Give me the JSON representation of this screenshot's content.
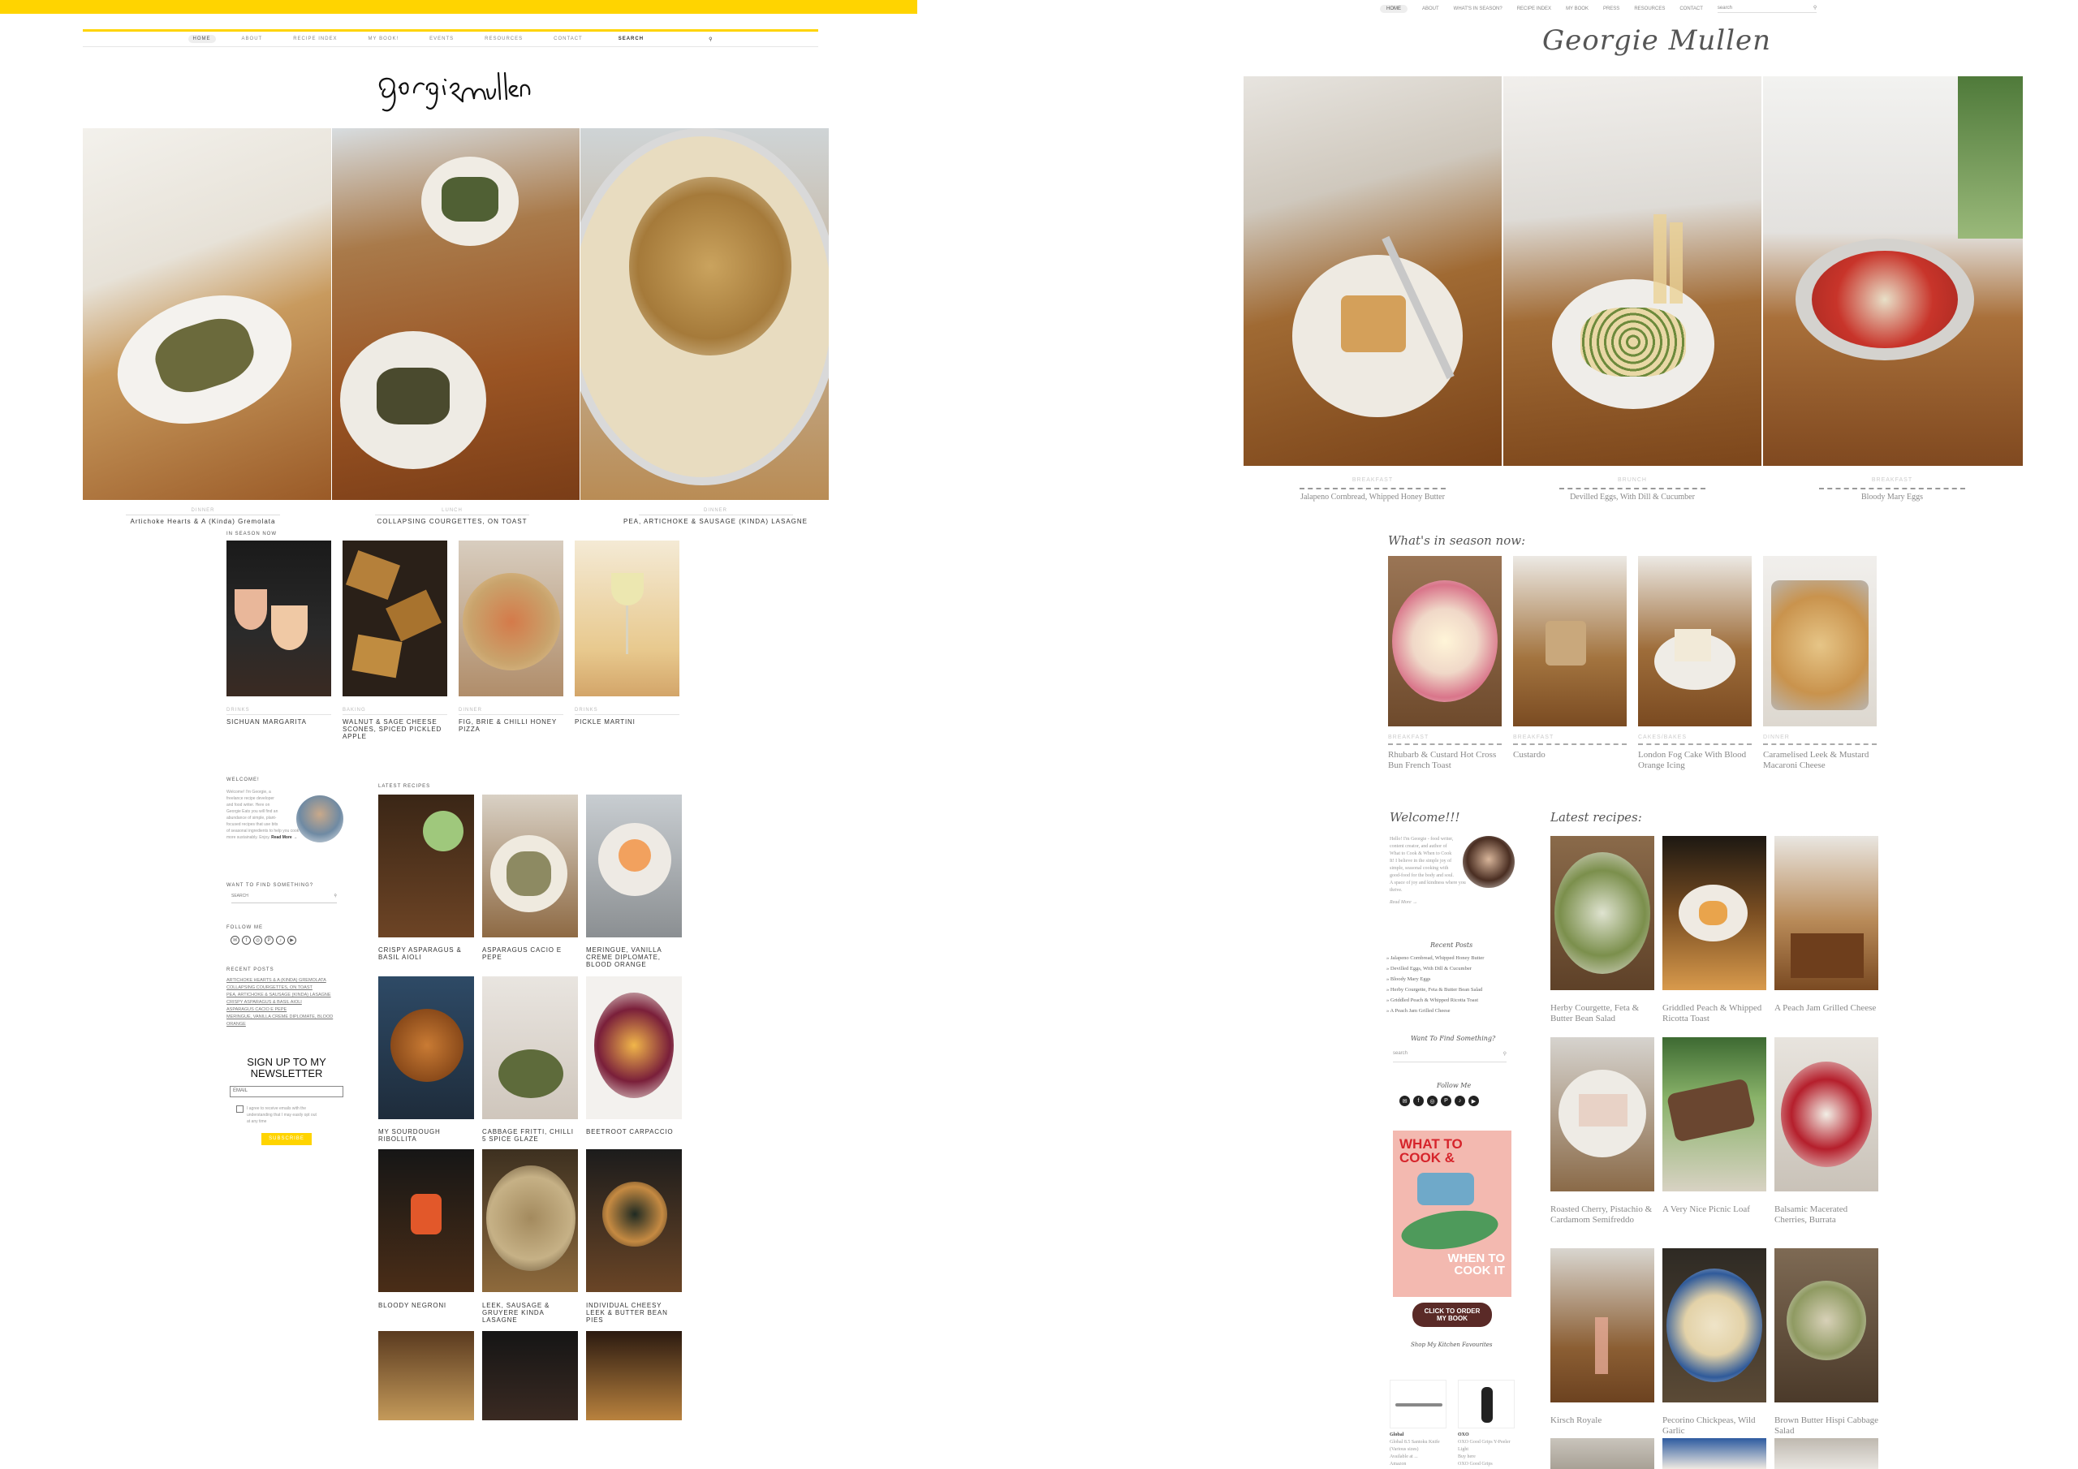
{
  "left": {
    "nav": {
      "items": [
        "HOME",
        "ABOUT",
        "RECIPE INDEX",
        "MY BOOK!",
        "EVENTS",
        "RESOURCES",
        "CONTACT"
      ],
      "search_label": "SEARCH"
    },
    "hero": [
      {
        "category": "DINNER",
        "title": "Artichoke Hearts & A (Kinda) Gremolata"
      },
      {
        "category": "LUNCH",
        "title": "COLLAPSING COURGETTES, ON TOAST"
      },
      {
        "category": "DINNER",
        "title": "PEA, ARTICHOKE & SAUSAGE (KINDA) LASAGNE"
      }
    ],
    "in_season": {
      "heading": "IN SEASON NOW",
      "cards": [
        {
          "category": "DRINKS",
          "title": "SICHUAN MARGARITA"
        },
        {
          "category": "BAKING",
          "title": "WALNUT & SAGE CHEESE SCONES, SPICED PICKLED APPLE"
        },
        {
          "category": "DINNER",
          "title": "FIG, BRIE & CHILLI HONEY PIZZA"
        },
        {
          "category": "DRINKS",
          "title": "PICKLE MARTINI"
        }
      ]
    },
    "sidebar": {
      "welcome_heading": "WELCOME!",
      "welcome_lines": [
        "Welcome! I'm Georgie, a",
        "freelance recipe developer",
        "and food writer. Here on",
        "Georgie Eats you will find an",
        "abundance of simple, plant-",
        "focused recipes that use bits",
        "of seasonal ingredients to help you cook and live",
        "more sustainably. Enjoy."
      ],
      "read_more": "Read More →",
      "find_heading": "WANT TO FIND SOMETHING?",
      "search_placeholder": "SEARCH",
      "follow_heading": "FOLLOW ME",
      "social": [
        "✉",
        "f",
        "◎",
        "P",
        "♪",
        "▶"
      ],
      "recent_heading": "RECENT POSTS",
      "recent_posts": [
        "ARTICHOKE HEARTS & A (KINDA) GREMOLATA",
        "COLLAPSING COURGETTES, ON TOAST",
        "PEA, ARTICHOKE & SAUSAGE (KINDA) LASAGNE",
        "CRISPY ASPARAGUS & BASIL AIOLI",
        "ASPARAGUS CACIO E PEPE",
        "MERINGUE, VANILLA CREME DIPLOMATE, BLOOD ORANGE"
      ],
      "newsletter_title_1": "SIGN UP TO MY",
      "newsletter_title_2": "NEWSLETTER",
      "email_placeholder": "EMAIL",
      "consent_lines": [
        "I agree to receive emails with the",
        "understanding that I may easily opt out",
        "at any time"
      ],
      "subscribe_label": "SUBSCRIBE"
    },
    "latest": {
      "heading": "LATEST RECIPES",
      "cards": [
        {
          "title": "CRISPY ASPARAGUS & BASIL AIOLI"
        },
        {
          "title": "ASPARAGUS CACIO E PEPE"
        },
        {
          "title": "MERINGUE, VANILLA CREME DIPLOMATE, BLOOD ORANGE"
        },
        {
          "title": "MY SOURDOUGH RIBOLLITA"
        },
        {
          "title": "CABBAGE FRITTI, CHILLI 5 SPICE GLAZE"
        },
        {
          "title": "BEETROOT CARPACCIO"
        },
        {
          "title": "BLOODY NEGRONI"
        },
        {
          "title": "LEEK, SAUSAGE & GRUYERE KINDA LASAGNE"
        },
        {
          "title": "INDIVIDUAL CHEESY LEEK & BUTTER BEAN PIES"
        }
      ]
    }
  },
  "right": {
    "nav": {
      "items": [
        "HOME",
        "ABOUT",
        "WHAT'S IN SEASON?",
        "RECIPE INDEX",
        "MY BOOK",
        "PRESS",
        "RESOURCES",
        "CONTACT"
      ],
      "search_placeholder": "search"
    },
    "logo": "Georgie Mullen",
    "hero": [
      {
        "category": "BREAKFAST",
        "title": "Jalapeno Cornbread, Whipped Honey Butter"
      },
      {
        "category": "BRUNCH",
        "title": "Devilled Eggs, With Dill & Cucumber"
      },
      {
        "category": "BREAKFAST",
        "title": "Bloody Mary Eggs"
      }
    ],
    "in_season": {
      "heading": "What's in season now:",
      "cards": [
        {
          "category": "BREAKFAST",
          "title": "Rhubarb & Custard Hot Cross Bun French Toast"
        },
        {
          "category": "BREAKFAST",
          "title": "Custardo"
        },
        {
          "category": "CAKES/BAKES",
          "title": "London Fog Cake With Blood Orange Icing"
        },
        {
          "category": "DINNER",
          "title": "Caramelised Leek & Mustard Macaroni Cheese"
        }
      ]
    },
    "sidebar": {
      "welcome_heading": "Welcome!!!",
      "welcome_lines": [
        "Hello! I'm Georgie - food writer,",
        "content creator, and author of",
        "What to Cook & When to Cook",
        "It! I believe in the simple joy of",
        "simple, seasonal cooking with",
        "good-food for the body and soul.",
        "A space of joy and kindness where you",
        "thrive."
      ],
      "read_more": "Read More →",
      "recent_heading": "Recent Posts",
      "recent_posts": [
        "Jalapeno Cornbread, Whipped Honey Butter",
        "Devilled Eggs, With Dill & Cucumber",
        "Bloody Mary Eggs",
        "Herby Courgette, Feta & Butter Bean Salad",
        "Griddled Peach & Whipped Ricotta Toast",
        "A Peach Jam Grilled Cheese"
      ],
      "find_heading": "Want To Find Something?",
      "search_placeholder": "search",
      "follow_heading": "Follow Me",
      "social": [
        "✉",
        "f",
        "◎",
        "P",
        "♪",
        "▶"
      ],
      "book_title_1": "WHAT TO",
      "book_title_2": "COOK &",
      "book_title_3": "WHEN TO",
      "book_title_4": "COOK IT",
      "book_button_1": "CLICK TO ORDER",
      "book_button_2": "MY BOOK",
      "shop_heading": "Shop My Kitchen Favourites",
      "shop_items": [
        {
          "brand": "Global",
          "lines": [
            "Global 8.5 Santoku Knife",
            "(Various sizes)",
            "Available at ...",
            "Amazon"
          ]
        },
        {
          "brand": "OXO",
          "lines": [
            "OXO Good Grips Y-Peeler",
            "Light",
            "Buy here",
            "OXO Good Grips",
            "Y-Peeler £11.00"
          ]
        }
      ]
    },
    "latest": {
      "heading": "Latest recipes:",
      "cards": [
        {
          "title": "Herby Courgette, Feta & Butter Bean Salad"
        },
        {
          "title": "Griddled Peach & Whipped Ricotta Toast"
        },
        {
          "title": "A Peach Jam Grilled Cheese"
        },
        {
          "title": "Roasted Cherry, Pistachio & Cardamom Semifreddo"
        },
        {
          "title": "A Very Nice Picnic Loaf"
        },
        {
          "title": "Balsamic Macerated Cherries, Burrata"
        },
        {
          "title": "Kirsch Royale"
        },
        {
          "title": "Pecorino Chickpeas, Wild Garlic"
        },
        {
          "title": "Brown Butter Hispi Cabbage Salad"
        }
      ]
    }
  },
  "colors": {
    "accent_yellow": "#ffd400",
    "book_pink": "#f3b9b0",
    "book_red": "#d6242b"
  }
}
